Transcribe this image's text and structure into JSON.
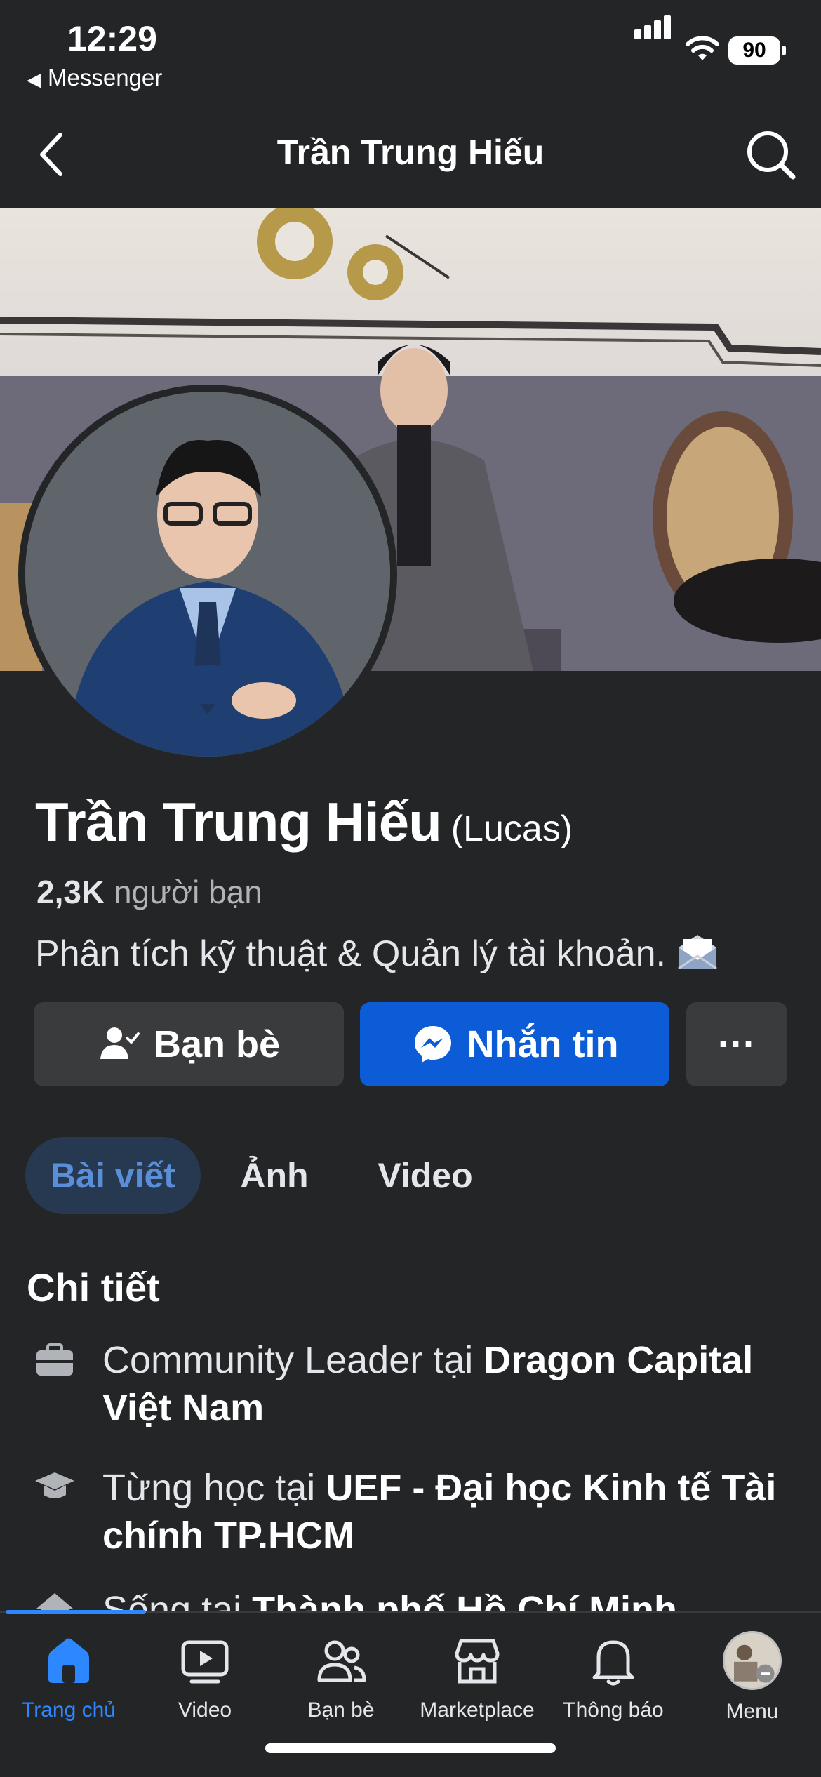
{
  "status_bar": {
    "time": "12:29",
    "back_app": "Messenger",
    "battery": "90"
  },
  "header": {
    "title": "Trần Trung Hiếu",
    "back_icon": "chevron-left-icon",
    "search_icon": "search-icon"
  },
  "profile": {
    "name": "Trần Trung Hiếu",
    "nickname": "(Lucas)",
    "friend_count": "2,3K",
    "friend_label": "người bạn",
    "bio": "Phân tích kỹ thuật & Quản lý tài khoản."
  },
  "actions": {
    "friends_label": "Bạn bè",
    "message_label": "Nhắn tin",
    "more_label": "···"
  },
  "tabs": [
    {
      "label": "Bài viết",
      "active": true
    },
    {
      "label": "Ảnh",
      "active": false
    },
    {
      "label": "Video",
      "active": false
    }
  ],
  "details": {
    "title": "Chi tiết",
    "work_prefix": "Community Leader tại ",
    "work_place": "Dragon Capital Việt Nam",
    "edu_prefix": "Từng học tại ",
    "edu_place": "UEF - Đại học Kinh tế Tài chính TP.HCM",
    "live_prefix": "Sống tại ",
    "live_place": "Thành phố Hồ Chí Minh"
  },
  "bottom_nav": [
    {
      "label": "Trang chủ",
      "icon": "home-icon",
      "active": true
    },
    {
      "label": "Video",
      "icon": "video-icon",
      "active": false
    },
    {
      "label": "Bạn bè",
      "icon": "friends-icon",
      "active": false
    },
    {
      "label": "Marketplace",
      "icon": "marketplace-icon",
      "active": false
    },
    {
      "label": "Thông báo",
      "icon": "bell-icon",
      "active": false
    },
    {
      "label": "Menu",
      "icon": "avatar",
      "active": false
    }
  ],
  "colors": {
    "background": "#242526",
    "accent": "#0b5cd6",
    "active_tab_bg": "#263951",
    "active_nav": "#2d88ff"
  }
}
